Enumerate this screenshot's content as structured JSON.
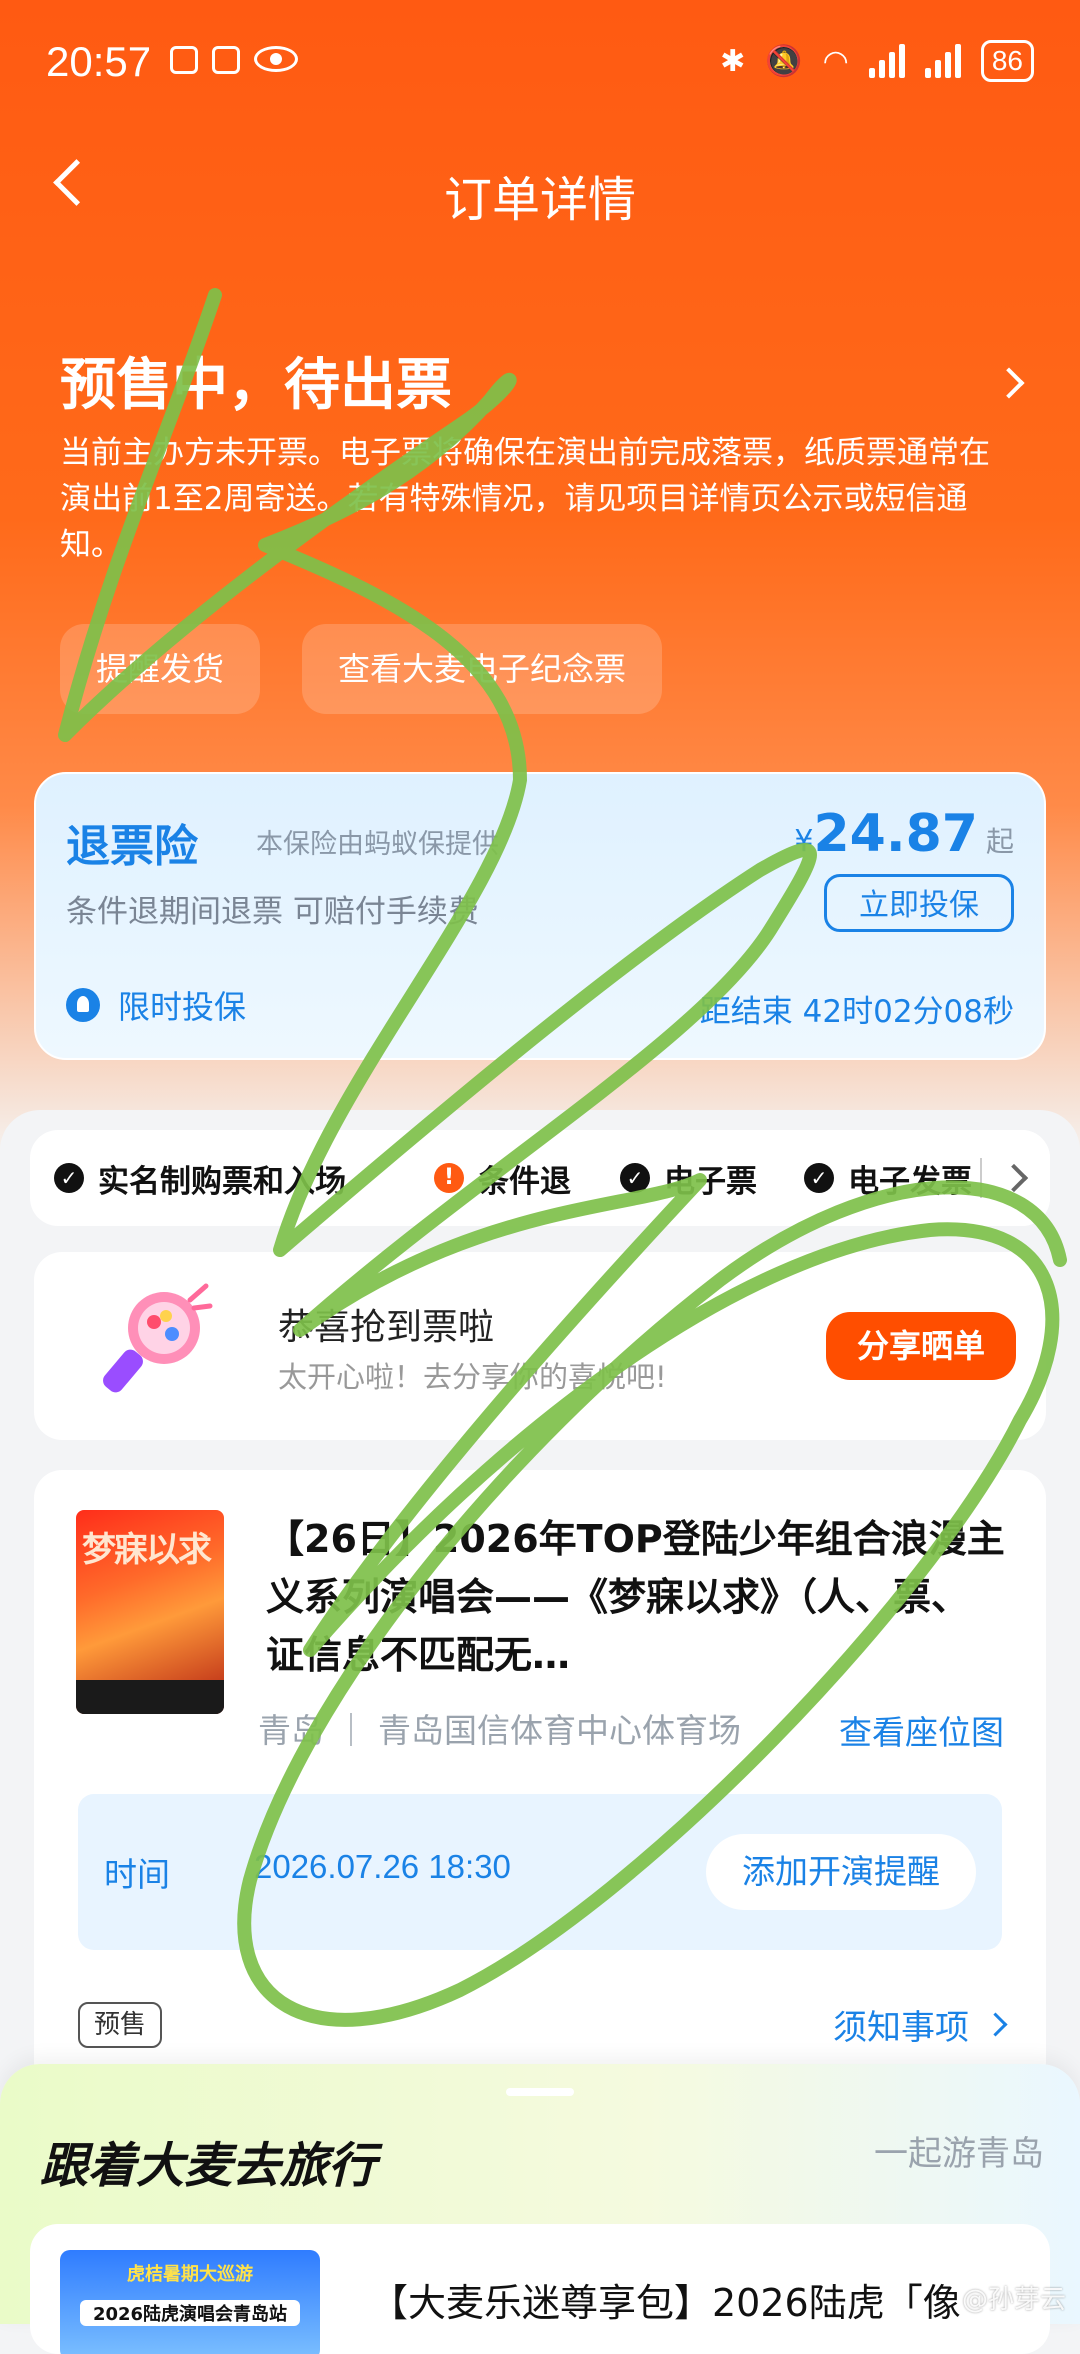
{
  "status_bar": {
    "time": "20:57",
    "battery": "86"
  },
  "nav": {
    "title": "订单详情"
  },
  "state": {
    "title": "预售中，待出票",
    "desc": "当前主办方未开票。电子票将确保在演出前完成落票，纸质票通常在演出前1至2周寄送。若有特殊情况，请见项目详情页公示或短信通知。",
    "btn_remind": "提醒发货",
    "btn_souvenir": "查看大麦电子纪念票"
  },
  "insurance": {
    "name": "退票险",
    "provider": "本保险由蚂蚁保提供",
    "currency": "¥",
    "price": "24.87",
    "price_suffix": "起",
    "condition": "条件退期间退票 可赔付手续费",
    "buy_label": "立即投保",
    "limited": "限时投保",
    "countdown": "距结束 42时02分08秒"
  },
  "tags": [
    {
      "label": "实名制购票和入场",
      "icon": "check"
    },
    {
      "label": "条件退",
      "icon": "warning"
    },
    {
      "label": "电子票",
      "icon": "check"
    },
    {
      "label": "电子发票",
      "icon": "check"
    }
  ],
  "congrats": {
    "title": "恭喜抢到票啦",
    "sub": "太开心啦！去分享你的喜悦吧!",
    "share_label": "分享晒单"
  },
  "order": {
    "poster_text": "梦寐以求",
    "title": "【26日】2026年TOP登陆少年组合浪漫主义系列演唱会——《梦寐以求》（人、票、证信息不匹配无…",
    "venue": "青岛 ｜ 青岛国信体育中心体育场",
    "seat_label": "查看座位图",
    "time_label": "时间",
    "time_value": "2026.07.26 18:30",
    "reminder_label": "添加开演提醒",
    "presale_badge": "预售",
    "notice_label": "须知事项"
  },
  "travel": {
    "title": "跟着大麦去旅行",
    "right": "一起游青岛",
    "thumb_top": "虎桔暑期大巡游",
    "thumb_label": "2026陆虎演唱会青岛站",
    "item_title": "【大麦乐迷尊享包】2026陆虎「像"
  },
  "watermark": "@孙芽云",
  "colors": {
    "brand_orange": "#ff5a12",
    "blue": "#1a82e6",
    "scribble": "#7ec04a"
  }
}
